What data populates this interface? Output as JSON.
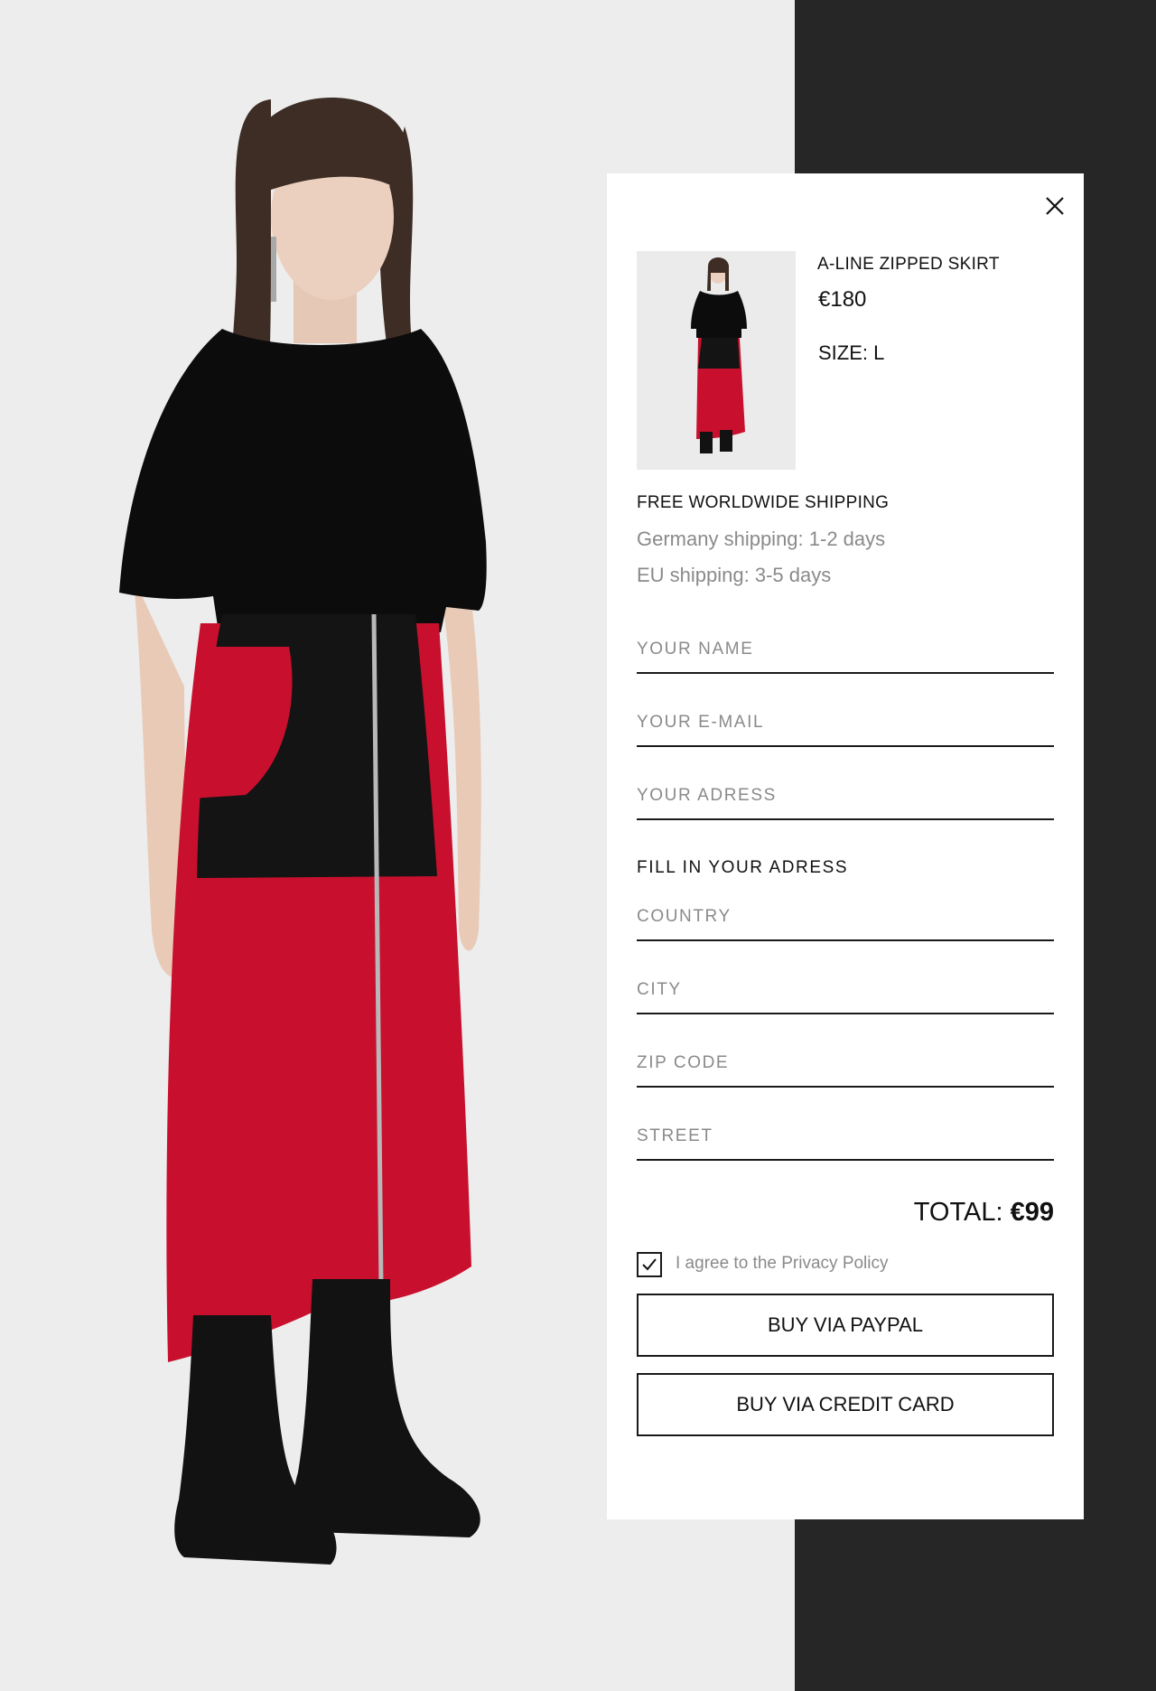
{
  "product": {
    "name": "A-LINE ZIPPED SKIRT",
    "price": "€180",
    "size": "SIZE: L"
  },
  "shipping": {
    "title": "FREE WORLDWIDE SHIPPING",
    "lines": [
      "Germany shipping: 1-2 days",
      "EU shipping: 3-5 days"
    ]
  },
  "form": {
    "name_placeholder": "YOUR NAME",
    "email_placeholder": "YOUR E-MAIL",
    "address_placeholder": "YOUR ADRESS",
    "address_section_title": "FILL IN YOUR ADRESS",
    "country_placeholder": "COUNTRY",
    "city_placeholder": "CITY",
    "zip_placeholder": "ZIP CODE",
    "street_placeholder": "STREET"
  },
  "total": {
    "label": "TOTAL:",
    "value": "€99"
  },
  "privacy": {
    "text": "I agree to the Privacy Policy",
    "checked": true
  },
  "buttons": {
    "paypal": "BUY VIA PAYPAL",
    "credit_card": "BUY VIA CREDIT CARD"
  },
  "icons": {
    "close": "close-icon",
    "checkbox": "checkmark-icon"
  },
  "colors": {
    "skirt_red": "#c8102e",
    "dark_sidebar": "#262626",
    "page_background": "#ededed",
    "muted_text": "#8a8a8a"
  }
}
